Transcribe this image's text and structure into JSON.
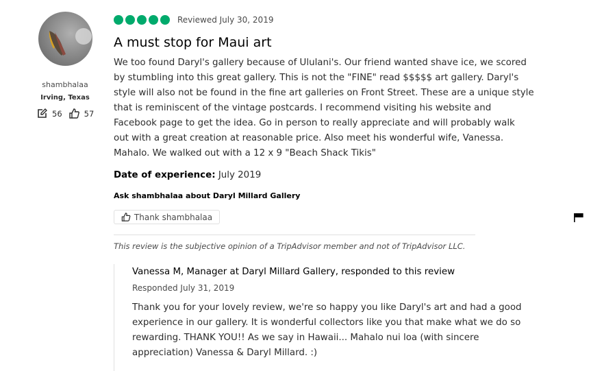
{
  "reviewer": {
    "username": "shambhalaa",
    "location": "Irving, Texas",
    "contributions": "56",
    "helpful_votes": "57"
  },
  "review": {
    "rating": 5,
    "reviewed_date": "Reviewed July 30, 2019",
    "title": "A must stop for Maui art",
    "body_lines": [
      "We too found Daryl's gallery because of Ululani's. Our friend wanted shave ice, we scored",
      "by stumbling into this great gallery. This is not the \"FINE\" read $$$$$ art gallery. Daryl's",
      "style will also not be found in the fine art galleries on Front Street. These are a unique style",
      "that is reminiscent of the vintage postcards. I recommend visiting his website and",
      "Facebook page to get the idea. Go in person to really appreciate and will probably walk",
      "out with a great creation at reasonable price. Also meet his wonderful wife, Vanessa.",
      "Mahalo. We walked out with a 12 x 9 \"Beach Shack Tikis\""
    ],
    "date_of_experience_label": "Date of experience:",
    "date_of_experience": "July 2019",
    "ask_text": "Ask shambhalaa about Daryl Millard Gallery",
    "thank_button": "Thank shambhalaa",
    "disclaimer": "This review is the subjective opinion of a TripAdvisor member and not of TripAdvisor LLC."
  },
  "response": {
    "header": "Vanessa M, Manager at Daryl Millard Gallery, responded to this review",
    "date": "Responded July 31, 2019",
    "body_lines": [
      "Thank you for your lovely review, we're so happy you like Daryl's art and had a good",
      "experience in our gallery. It is wonderful collectors like you that make what we do so",
      "rewarding. THANK YOU!! As we say in Hawaii... Mahalo nui loa (with sincere",
      "appreciation) Vanessa & Daryl Millard. :)"
    ]
  },
  "colors": {
    "bubble": "#00aa6c",
    "text": "#2c2c2c"
  },
  "icons": [
    "pencil-icon",
    "thumbs-up-icon",
    "flag-icon"
  ]
}
